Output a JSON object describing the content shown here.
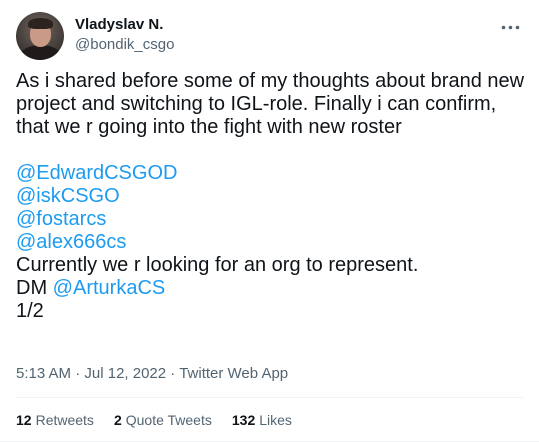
{
  "author": {
    "display_name": "Vladyslav N.",
    "handle": "@bondik_csgo"
  },
  "tweet": {
    "line1": "As i shared before some of my thoughts about brand new project and switching to IGL-role. Finally i can confirm, that we r going into the fight with new roster",
    "flag": "ukraine-flag",
    "mentions": [
      "@EdwardCSGOD",
      "@iskCSGO",
      "@fostarcs",
      "@alex666cs"
    ],
    "line_org": "Currently we r looking for an org to represent.",
    "dm_prefix": "DM",
    "dm_mention": "@ArturkaCS",
    "thread_count": "1/2"
  },
  "meta": {
    "time": "5:13 AM",
    "separator": " · ",
    "date": "Jul 12, 2022",
    "source": "Twitter Web App"
  },
  "stats": {
    "retweets_count": "12",
    "retweets_label": "Retweets",
    "quotes_count": "2",
    "quotes_label": "Quote Tweets",
    "likes_count": "132",
    "likes_label": "Likes"
  },
  "colors": {
    "text": "#0f1419",
    "secondary": "#536471",
    "link": "#1d9bf0",
    "divider": "#eff3f4"
  }
}
